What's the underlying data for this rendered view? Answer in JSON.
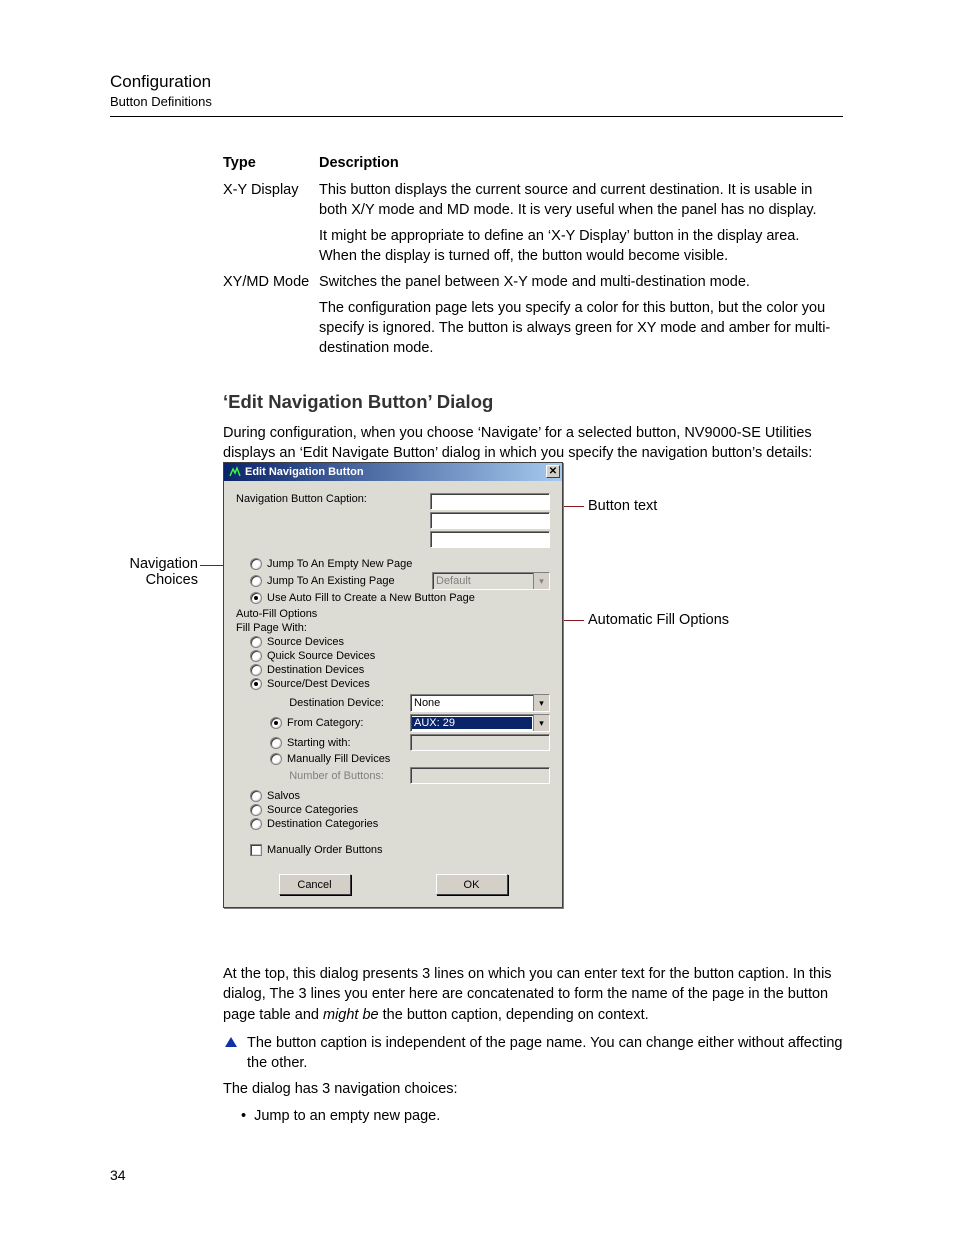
{
  "header": {
    "title": "Configuration",
    "subtitle": "Button Definitions"
  },
  "table": {
    "head_type": "Type",
    "head_desc": "Description",
    "row1_type": "X-Y Display",
    "row1_p1": "This button displays the current source and current destination. It is usable in both X/Y mode and MD mode. It is very useful when the panel has no display.",
    "row1_p2": "It might be appropriate to define an ‘X-Y Display’ button in the display area. When the display is turned off, the button would become visible.",
    "row2_type": "XY/MD Mode",
    "row2_p1": "Switches the panel between X-Y mode and multi-destination mode.",
    "row2_p2": "The configuration page lets you specify a color for this button, but the color you specify is ignored. The button is always green for XY mode and amber for multi-destination mode."
  },
  "section_heading": "‘Edit Navigation Button’ Dialog",
  "intro": "During configuration, when you choose ‘Navigate’ for a selected button, NV9000-SE Utilities displays an ‘Edit Navigate Button’ dialog in which you specify the navigation button’s details:",
  "callouts": {
    "nav_choices_l1": "Navigation",
    "nav_choices_l2": "Choices",
    "button_text": "Button text",
    "auto_fill": "Automatic Fill Options"
  },
  "dialog": {
    "title": "Edit Navigation Button",
    "caption_label": "Navigation Button Caption:",
    "nav_opts": {
      "empty": "Jump To An Empty New Page",
      "existing": "Jump To An Existing Page",
      "existing_value": "Default",
      "autofill": "Use Auto Fill to Create a New Button Page"
    },
    "autofill_section": "Auto-Fill Options",
    "fill_label": "Fill Page With:",
    "fill": {
      "source": "Source Devices",
      "quick": "Quick Source Devices",
      "dest": "Destination Devices",
      "srcdst": "Source/Dest Devices",
      "dest_device_label": "Destination Device:",
      "dest_device_value": "None",
      "from_cat": "From Category:",
      "from_cat_value": "AUX: 29",
      "starting": "Starting with:",
      "manual_fill": "Manually Fill Devices",
      "num_buttons": "Number of Buttons:",
      "salvos": "Salvos",
      "src_cats": "Source Categories",
      "dst_cats": "Destination Categories",
      "manual_order": "Manually Order Buttons"
    },
    "cancel": "Cancel",
    "ok": "OK"
  },
  "after": {
    "p1a": "At the top, this dialog presents 3 lines on which you can enter text for the button caption. In this dialog, The 3 lines you enter here are concatenated to form the name of the page in the button page table and ",
    "p1_em": "might be",
    "p1b": " the button caption, depending on context.",
    "note": "The button caption is independent of the page name. You can change either without affecting the other.",
    "p2": "The dialog has 3 navigation choices:",
    "b1": "Jump to an empty new page."
  },
  "page_number": "34"
}
